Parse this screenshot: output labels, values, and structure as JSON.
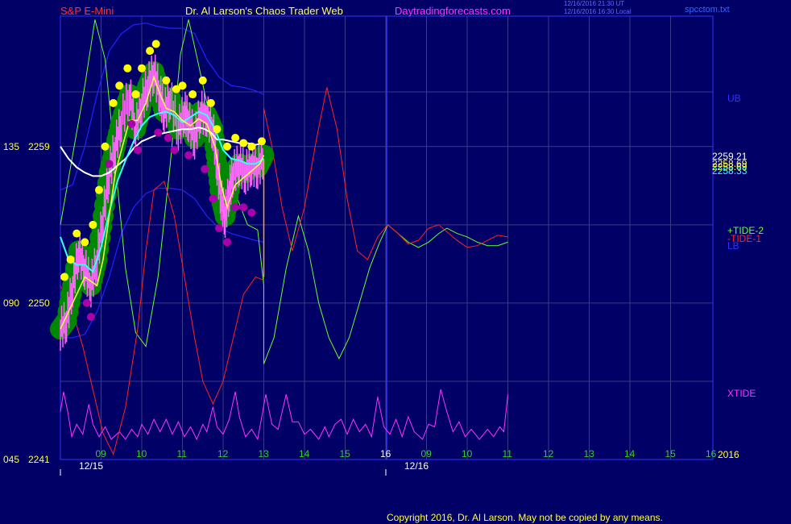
{
  "header": {
    "symbol": "S&P E-Mini",
    "site_title": "Dr. Al Larson's Chaos Trader Web",
    "site_url": "Daytradingforecasts.com",
    "timestamp_ut": "12/16/2016 21:30 UT",
    "timestamp_local": "12/16/2016 16:30 Local",
    "filename": "spcctom.txt"
  },
  "footer": {
    "copyright": "Copyright 2016, Dr. Al Larson. May not be copied by any means."
  },
  "year_label": "2016",
  "colors": {
    "background": "#000066",
    "grid": "#3a3a8a",
    "frame": "#3333ff",
    "price_bar": "#ff66ff",
    "glow": "#008800",
    "high_dot": "#ffff00",
    "low_dot": "#aa00aa",
    "short_ma": "#ffff44",
    "mid_ma": "#33ffff",
    "long_ma": "#ffffff",
    "bands": "#2222ff",
    "tide2": "#66ff33",
    "tide1": "#ff2222",
    "xtide": "#ff33ff"
  },
  "chart_data": {
    "type": "line",
    "y_axis_labels": [
      {
        "code": "135",
        "price": "2259",
        "value": 2259
      },
      {
        "code": "090",
        "price": "2250",
        "value": 2250
      },
      {
        "code": "045",
        "price": "2241",
        "value": 2241
      }
    ],
    "ylim": [
      2241,
      2266.5
    ],
    "x_ticks_day1": [
      "09",
      "10",
      "11",
      "12",
      "13",
      "14",
      "15"
    ],
    "x_ticks_day2": [
      "16",
      "09",
      "10",
      "11",
      "12",
      "13",
      "14",
      "15",
      "16"
    ],
    "date_labels": [
      "12/15",
      "12/16"
    ],
    "right_labels": {
      "ub": "UB",
      "lb": "LB",
      "tide2": "+TIDE-2",
      "tide1": "-TIDE-1",
      "xtide": "XTIDE",
      "values": [
        "2259.21",
        "2258.69",
        "2258.69",
        "2258.33"
      ]
    },
    "price_path": [
      [
        0.0,
        2248.5
      ],
      [
        0.15,
        2249
      ],
      [
        0.3,
        2251
      ],
      [
        0.45,
        2253
      ],
      [
        0.6,
        2252
      ],
      [
        0.75,
        2251
      ],
      [
        0.9,
        2252.5
      ],
      [
        1.05,
        2255
      ],
      [
        1.2,
        2257.5
      ],
      [
        1.35,
        2259
      ],
      [
        1.5,
        2260.5
      ],
      [
        1.7,
        2262
      ],
      [
        1.85,
        2260
      ],
      [
        2.0,
        2261.5
      ],
      [
        2.15,
        2262.5
      ],
      [
        2.3,
        2263.3
      ],
      [
        2.45,
        2262
      ],
      [
        2.55,
        2261
      ],
      [
        2.7,
        2261.8
      ],
      [
        2.9,
        2260
      ],
      [
        3.05,
        2261
      ],
      [
        3.15,
        2260.5
      ],
      [
        3.3,
        2259.5
      ],
      [
        3.45,
        2261
      ],
      [
        3.6,
        2260.8
      ],
      [
        3.75,
        2260
      ],
      [
        3.85,
        2258
      ],
      [
        3.95,
        2256
      ],
      [
        4.05,
        2255
      ],
      [
        4.15,
        2256.5
      ],
      [
        4.25,
        2257.5
      ],
      [
        4.4,
        2258
      ],
      [
        4.55,
        2257.5
      ],
      [
        4.7,
        2258
      ],
      [
        4.85,
        2257.8
      ],
      [
        5.0,
        2258.5
      ]
    ],
    "highs": [
      [
        0.1,
        2251.5
      ],
      [
        0.25,
        2252.5
      ],
      [
        0.4,
        2254
      ],
      [
        0.6,
        2253.5
      ],
      [
        0.8,
        2254.5
      ],
      [
        0.95,
        2256.5
      ],
      [
        1.1,
        2259
      ],
      [
        1.3,
        2261.5
      ],
      [
        1.45,
        2262.5
      ],
      [
        1.65,
        2263.5
      ],
      [
        1.85,
        2262
      ],
      [
        2.0,
        2263.5
      ],
      [
        2.2,
        2264.5
      ],
      [
        2.35,
        2264.9
      ],
      [
        2.6,
        2262.8
      ],
      [
        2.85,
        2262.3
      ],
      [
        3.0,
        2262.5
      ],
      [
        3.25,
        2262
      ],
      [
        3.5,
        2262.8
      ],
      [
        3.7,
        2261.5
      ],
      [
        3.85,
        2260
      ],
      [
        4.1,
        2259
      ],
      [
        4.3,
        2259.5
      ],
      [
        4.5,
        2259.2
      ],
      [
        4.7,
        2259
      ],
      [
        4.95,
        2259.3
      ]
    ],
    "lows": [
      [
        0.65,
        2250
      ],
      [
        0.75,
        2249.2
      ],
      [
        1.2,
        2258
      ],
      [
        1.75,
        2260.3
      ],
      [
        1.9,
        2258.8
      ],
      [
        2.4,
        2259.8
      ],
      [
        2.65,
        2259.5
      ],
      [
        2.8,
        2258.8
      ],
      [
        3.15,
        2258.5
      ],
      [
        3.55,
        2257.7
      ],
      [
        3.75,
        2256
      ],
      [
        3.9,
        2254.3
      ],
      [
        4.1,
        2253.5
      ],
      [
        4.3,
        2255.5
      ],
      [
        4.5,
        2255.5
      ],
      [
        4.7,
        2255.2
      ]
    ],
    "short_ma": [
      [
        0.0,
        2248.5
      ],
      [
        0.3,
        2250
      ],
      [
        0.6,
        2251.5
      ],
      [
        0.9,
        2251
      ],
      [
        1.05,
        2252.5
      ],
      [
        1.2,
        2255
      ],
      [
        1.35,
        2257.5
      ],
      [
        1.5,
        2258.8
      ],
      [
        1.7,
        2260.5
      ],
      [
        1.9,
        2260.5
      ],
      [
        2.1,
        2261.5
      ],
      [
        2.3,
        2263
      ],
      [
        2.45,
        2262
      ],
      [
        2.6,
        2261.2
      ],
      [
        2.8,
        2261
      ],
      [
        3.0,
        2260.5
      ],
      [
        3.2,
        2260.2
      ],
      [
        3.4,
        2260.6
      ],
      [
        3.6,
        2260.3
      ],
      [
        3.8,
        2259
      ],
      [
        3.95,
        2256.8
      ],
      [
        4.1,
        2255.5
      ],
      [
        4.3,
        2256.8
      ],
      [
        4.5,
        2257.2
      ],
      [
        4.7,
        2257.6
      ],
      [
        4.9,
        2258
      ],
      [
        5.0,
        2258.5
      ]
    ],
    "mid_ma": [
      [
        0.0,
        2253.8
      ],
      [
        0.2,
        2252.5
      ],
      [
        0.4,
        2252.2
      ],
      [
        0.6,
        2252.2
      ],
      [
        0.8,
        2251.8
      ],
      [
        1.0,
        2253.2
      ],
      [
        1.2,
        2255.2
      ],
      [
        1.4,
        2257
      ],
      [
        1.6,
        2258.2
      ],
      [
        1.8,
        2259.3
      ],
      [
        2.0,
        2260.2
      ],
      [
        2.2,
        2260.7
      ],
      [
        2.4,
        2260.9
      ],
      [
        2.6,
        2261
      ],
      [
        2.8,
        2260.8
      ],
      [
        3.0,
        2260.4
      ],
      [
        3.2,
        2260.7
      ],
      [
        3.4,
        2261
      ],
      [
        3.6,
        2260.8
      ],
      [
        3.8,
        2260
      ],
      [
        4.0,
        2258.8
      ],
      [
        4.2,
        2258.3
      ],
      [
        4.4,
        2258.2
      ],
      [
        4.6,
        2258
      ],
      [
        4.8,
        2258
      ],
      [
        5.0,
        2258.3
      ]
    ],
    "long_ma": [
      [
        0.0,
        2259
      ],
      [
        0.2,
        2258.3
      ],
      [
        0.4,
        2257.8
      ],
      [
        0.6,
        2257.5
      ],
      [
        0.8,
        2257.3
      ],
      [
        1.0,
        2257.3
      ],
      [
        1.2,
        2257.5
      ],
      [
        1.4,
        2257.9
      ],
      [
        1.6,
        2258.3
      ],
      [
        1.8,
        2258.9
      ],
      [
        2.0,
        2259.3
      ],
      [
        2.2,
        2259.5
      ],
      [
        2.4,
        2259.7
      ],
      [
        2.6,
        2259.8
      ],
      [
        2.8,
        2259.9
      ],
      [
        3.0,
        2260
      ],
      [
        3.2,
        2260
      ],
      [
        3.4,
        2260.1
      ],
      [
        3.55,
        2260
      ],
      [
        3.7,
        2259.8
      ],
      [
        3.85,
        2259.4
      ],
      [
        4.0,
        2259.4
      ],
      [
        4.2,
        2259.3
      ],
      [
        4.4,
        2259.2
      ],
      [
        4.6,
        2259.2
      ],
      [
        4.8,
        2259.1
      ],
      [
        5.0,
        2259.2
      ]
    ],
    "upper_band": [
      [
        0.0,
        2256.5
      ],
      [
        0.3,
        2256.8
      ],
      [
        0.6,
        2259
      ],
      [
        0.9,
        2262
      ],
      [
        1.2,
        2264.5
      ],
      [
        1.5,
        2265.5
      ],
      [
        1.8,
        2266
      ],
      [
        2.1,
        2266.1
      ],
      [
        2.4,
        2265.9
      ],
      [
        2.7,
        2265.8
      ],
      [
        3.0,
        2265.8
      ],
      [
        3.3,
        2265.5
      ],
      [
        3.6,
        2264
      ],
      [
        3.9,
        2263
      ],
      [
        4.2,
        2262.5
      ],
      [
        4.5,
        2262.4
      ],
      [
        4.8,
        2262.2
      ],
      [
        5.0,
        2262
      ]
    ],
    "lower_band": [
      [
        0.0,
        2248
      ],
      [
        0.3,
        2248
      ],
      [
        0.6,
        2248.2
      ],
      [
        0.9,
        2249.5
      ],
      [
        1.2,
        2251.5
      ],
      [
        1.5,
        2254
      ],
      [
        1.8,
        2255.5
      ],
      [
        2.1,
        2256.3
      ],
      [
        2.4,
        2256.6
      ],
      [
        2.7,
        2256.6
      ],
      [
        3.0,
        2256.5
      ],
      [
        3.3,
        2256
      ],
      [
        3.6,
        2255
      ],
      [
        3.9,
        2254.3
      ],
      [
        4.2,
        2254
      ],
      [
        4.5,
        2253.8
      ],
      [
        4.8,
        2253.6
      ],
      [
        5.0,
        2253.5
      ]
    ],
    "tide2": [
      [
        0.0,
        2254.5
      ],
      [
        0.3,
        2258.5
      ],
      [
        0.6,
        2262.5
      ],
      [
        0.85,
        2266.3
      ],
      [
        1.1,
        2264
      ],
      [
        1.35,
        2258
      ],
      [
        1.6,
        2252
      ],
      [
        1.85,
        2248.3
      ],
      [
        2.1,
        2247.5
      ],
      [
        2.4,
        2251.5
      ],
      [
        2.7,
        2258
      ],
      [
        2.95,
        2264.3
      ],
      [
        3.15,
        2266.3
      ],
      [
        3.35,
        2264.2
      ],
      [
        3.6,
        2261.5
      ],
      [
        3.85,
        2259.5
      ],
      [
        4.1,
        2257.5
      ],
      [
        4.35,
        2256
      ],
      [
        4.6,
        2254.5
      ],
      [
        4.85,
        2254.2
      ],
      [
        5.0,
        2251
      ],
      [
        5.0,
        2246.5
      ],
      [
        5.25,
        2248
      ],
      [
        5.55,
        2252
      ],
      [
        5.85,
        2255
      ],
      [
        6.1,
        2253
      ],
      [
        6.35,
        2250
      ],
      [
        6.6,
        2248
      ],
      [
        6.85,
        2246.8
      ],
      [
        7.1,
        2248
      ],
      [
        7.35,
        2250
      ],
      [
        7.6,
        2252
      ],
      [
        7.85,
        2253.5
      ],
      [
        8.05,
        2254.5
      ],
      [
        8.3,
        2254
      ],
      [
        8.55,
        2253.5
      ],
      [
        8.8,
        2253.2
      ],
      [
        9.05,
        2253.5
      ],
      [
        9.3,
        2254
      ],
      [
        9.5,
        2254.3
      ],
      [
        9.75,
        2254
      ],
      [
        10.0,
        2253.8
      ],
      [
        10.25,
        2253.5
      ],
      [
        10.5,
        2253.3
      ],
      [
        10.75,
        2253.3
      ],
      [
        11.0,
        2253.5
      ]
    ],
    "tide1": [
      [
        0.0,
        2251
      ],
      [
        0.3,
        2249.5
      ],
      [
        0.55,
        2247.5
      ],
      [
        0.8,
        2245
      ],
      [
        1.05,
        2242.5
      ],
      [
        1.3,
        2241.3
      ],
      [
        1.6,
        2244
      ],
      [
        1.9,
        2248.5
      ],
      [
        2.1,
        2253
      ],
      [
        2.3,
        2256.5
      ],
      [
        2.55,
        2257
      ],
      [
        2.8,
        2255
      ],
      [
        3.05,
        2251.5
      ],
      [
        3.3,
        2248
      ],
      [
        3.5,
        2245.5
      ],
      [
        3.75,
        2244.2
      ],
      [
        4.0,
        2245.5
      ],
      [
        4.25,
        2248
      ],
      [
        4.5,
        2250.5
      ],
      [
        4.8,
        2251.5
      ],
      [
        5.0,
        2251.3
      ],
      [
        5.0,
        2261.2
      ],
      [
        5.2,
        2259
      ],
      [
        5.45,
        2255.5
      ],
      [
        5.7,
        2253
      ],
      [
        6.0,
        2255.5
      ],
      [
        6.3,
        2259.5
      ],
      [
        6.55,
        2262.4
      ],
      [
        6.8,
        2260
      ],
      [
        7.05,
        2256
      ],
      [
        7.3,
        2253
      ],
      [
        7.55,
        2252.5
      ],
      [
        7.8,
        2253.8
      ],
      [
        8.05,
        2254.5
      ],
      [
        8.3,
        2254
      ],
      [
        8.55,
        2253.4
      ],
      [
        8.8,
        2253.6
      ],
      [
        9.05,
        2254.3
      ],
      [
        9.3,
        2254.5
      ],
      [
        9.5,
        2254.1
      ],
      [
        9.75,
        2253.6
      ],
      [
        10.0,
        2253.2
      ],
      [
        10.25,
        2253.3
      ],
      [
        10.5,
        2253.6
      ],
      [
        10.75,
        2253.9
      ],
      [
        11.0,
        2253.8
      ]
    ],
    "xtide": [
      [
        0.0,
        0.6
      ],
      [
        0.08,
        1.0
      ],
      [
        0.18,
        0.6
      ],
      [
        0.28,
        0.1
      ],
      [
        0.4,
        0.35
      ],
      [
        0.55,
        0.15
      ],
      [
        0.7,
        0.75
      ],
      [
        0.8,
        0.35
      ],
      [
        0.95,
        0.1
      ],
      [
        1.1,
        0.3
      ],
      [
        1.25,
        0.05
      ],
      [
        1.45,
        0.2
      ],
      [
        1.6,
        0.05
      ],
      [
        1.75,
        0.25
      ],
      [
        1.9,
        0.1
      ],
      [
        2.0,
        0.35
      ],
      [
        2.15,
        0.15
      ],
      [
        2.3,
        0.45
      ],
      [
        2.45,
        0.2
      ],
      [
        2.6,
        0.45
      ],
      [
        2.75,
        0.15
      ],
      [
        2.9,
        0.4
      ],
      [
        3.05,
        0.1
      ],
      [
        3.2,
        0.3
      ],
      [
        3.35,
        0.05
      ],
      [
        3.5,
        0.35
      ],
      [
        3.6,
        0.2
      ],
      [
        3.75,
        0.7
      ],
      [
        3.85,
        0.3
      ],
      [
        4.0,
        0.15
      ],
      [
        4.15,
        0.45
      ],
      [
        4.3,
        1.0
      ],
      [
        4.4,
        0.5
      ],
      [
        4.55,
        0.1
      ],
      [
        4.7,
        0.25
      ],
      [
        4.85,
        0.05
      ],
      [
        5.05,
        0.95
      ],
      [
        5.2,
        0.35
      ],
      [
        5.35,
        0.25
      ],
      [
        5.55,
        0.95
      ],
      [
        5.7,
        0.4
      ],
      [
        5.85,
        0.4
      ],
      [
        6.0,
        0.15
      ],
      [
        6.15,
        0.25
      ],
      [
        6.35,
        0.05
      ],
      [
        6.5,
        0.3
      ],
      [
        6.6,
        0.1
      ],
      [
        6.75,
        0.35
      ],
      [
        6.9,
        0.45
      ],
      [
        7.05,
        0.15
      ],
      [
        7.2,
        0.45
      ],
      [
        7.35,
        0.2
      ],
      [
        7.5,
        0.35
      ],
      [
        7.65,
        0.1
      ],
      [
        7.8,
        0.9
      ],
      [
        7.95,
        0.3
      ],
      [
        8.1,
        0.15
      ],
      [
        8.25,
        0.45
      ],
      [
        8.4,
        0.1
      ],
      [
        8.55,
        0.5
      ],
      [
        8.7,
        0.2
      ],
      [
        8.9,
        0.05
      ],
      [
        9.05,
        0.35
      ],
      [
        9.2,
        0.3
      ],
      [
        9.35,
        1.05
      ],
      [
        9.5,
        0.6
      ],
      [
        9.65,
        0.2
      ],
      [
        9.8,
        0.4
      ],
      [
        9.95,
        0.1
      ],
      [
        10.1,
        0.25
      ],
      [
        10.3,
        0.05
      ],
      [
        10.5,
        0.25
      ],
      [
        10.65,
        0.1
      ],
      [
        10.8,
        0.3
      ],
      [
        10.9,
        0.2
      ],
      [
        11.0,
        0.95
      ]
    ]
  }
}
